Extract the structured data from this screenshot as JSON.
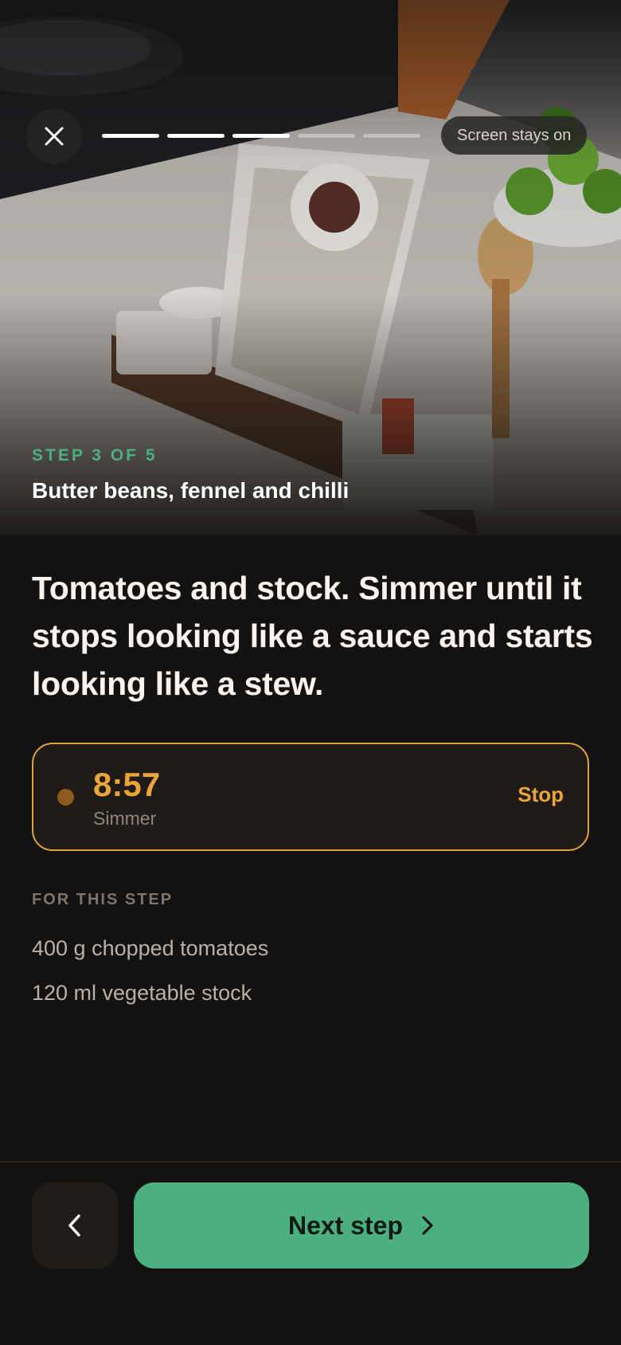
{
  "header": {
    "close_icon": "close-icon",
    "progress": {
      "current": 3,
      "total": 5
    },
    "screen_pill_label": "Screen stays on"
  },
  "hero": {
    "step_label": "STEP 3 OF 5",
    "recipe_title": "Butter beans, fennel and chilli"
  },
  "step": {
    "instruction": "Tomatoes and stock. Simmer until it stops looking like a sauce and starts looking like a stew."
  },
  "timer": {
    "time": "8:57",
    "label": "Simmer",
    "stop_label": "Stop"
  },
  "ingredients": {
    "heading": "FOR THIS STEP",
    "items": [
      "400 g chopped tomatoes",
      "120 ml vegetable stock"
    ]
  },
  "footer": {
    "back_icon": "chevron-left-icon",
    "next_label": "Next step",
    "next_icon": "chevron-right-icon"
  },
  "colors": {
    "accent_green": "#4caf7f",
    "timer_amber": "#e9a53a",
    "background": "#141210"
  }
}
